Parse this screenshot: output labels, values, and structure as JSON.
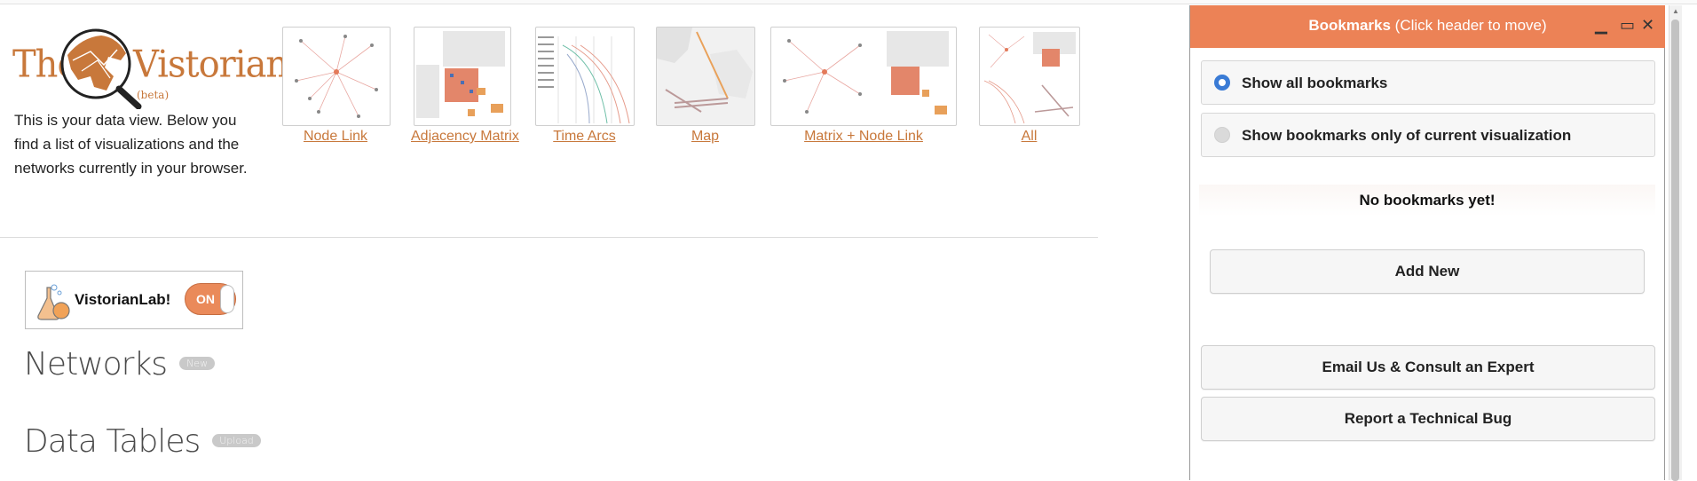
{
  "logo": {
    "word1": "The",
    "word2": "Vistorian",
    "beta": "(beta)"
  },
  "intro": {
    "text": "This is your data view. Below you find a list of visualizations and the networks currently in your browser."
  },
  "visualizations": [
    {
      "label": "Node Link"
    },
    {
      "label": "Adjacency Matrix"
    },
    {
      "label": "Time Arcs"
    },
    {
      "label": "Map"
    },
    {
      "label": "Matrix + Node Link"
    },
    {
      "label": "All"
    }
  ],
  "lab": {
    "label": "VistorianLab!",
    "toggle": "ON"
  },
  "sections": {
    "networks": {
      "title": "Networks",
      "badge": "New"
    },
    "tables": {
      "title": "Data Tables",
      "badge": "Upload"
    }
  },
  "bookmarks": {
    "title_bold": "Bookmarks",
    "title_hint": " (Click header to move)",
    "minimize": "▁",
    "maximize": "▭",
    "close": "✕",
    "option_all": "Show all bookmarks",
    "option_current": "Show bookmarks only of current visualization",
    "selected": "Show all bookmarks",
    "empty": "No bookmarks yet!",
    "add_new": "Add New",
    "email": "Email Us & Consult an Expert",
    "bug": "Report a Technical Bug"
  },
  "colors": {
    "accent": "#ec8256",
    "logo": "#c8783b",
    "link": "#c8783b",
    "radio": "#3a7bd5"
  }
}
